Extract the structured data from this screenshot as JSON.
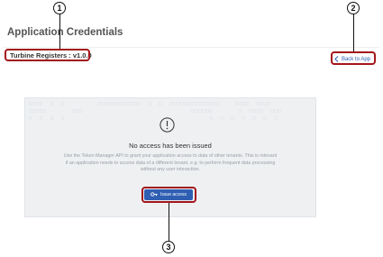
{
  "header": {
    "title": "Application Credentials",
    "subtitle": "Turbine Registers : v1.0.0",
    "back_label": "Back to App"
  },
  "panel": {
    "title": "No access has been issued",
    "description": "Use the Token Manager API to grant your application access to data of other tenants. This is relevant if an application needs to access data of a different tenant, e.g. to perform frequent data processing without any user interaction.",
    "issue_button_label": "Issue access"
  },
  "callouts": [
    "1",
    "2",
    "3"
  ],
  "colors": {
    "accent": "#2f5fb3",
    "callout": "#a3161a",
    "panel_bg": "#eef0f2"
  },
  "icons": [
    "exclamation-circle-icon",
    "chevron-left-icon",
    "key-icon"
  ]
}
